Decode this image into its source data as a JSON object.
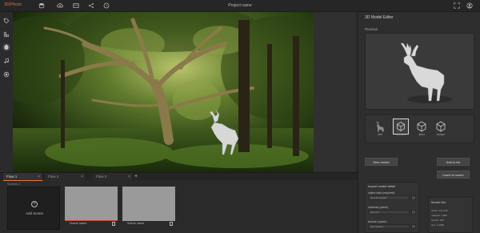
{
  "app": {
    "brand": "3DPhoto",
    "project_name": "Project name"
  },
  "topbar": {
    "icons": [
      "save-icon",
      "cloud-upload-icon",
      "preview-icon",
      "share-icon",
      "help-icon"
    ],
    "right_icons": [
      "fullscreen-icon",
      "account-icon"
    ]
  },
  "leftbar": {
    "icons": [
      "tag-icon",
      "layout-icon",
      "3d-model-icon",
      "music-icon",
      "marker-icon"
    ],
    "active_index": 2
  },
  "editor": {
    "title": "3D Model Editor",
    "preview_label": "Preview",
    "models": [
      {
        "label": "deer"
      },
      {
        "label": "selected"
      },
      {
        "label": "asset"
      },
      {
        "label": "custom"
      }
    ],
    "new_model_button": "New model",
    "add_to_list_button": "Add to list",
    "insert_button": "Insert to scene",
    "import": {
      "title": "Import model detail",
      "fields": [
        {
          "label": "object data (required)",
          "value": "deer.fbx/obj/gltf"
        },
        {
          "label": "material (option)",
          "value": "deer.mtl"
        },
        {
          "label": "texture (option)",
          "value": "deer.texture"
        }
      ]
    },
    "model_info": {
      "title": "Model info",
      "lines": [
        "vertex: 102,215",
        "material: 1,000",
        "texture: 200",
        "size: 1.2MB"
      ]
    }
  },
  "tabs": [
    {
      "label": "Flow 1",
      "active": true
    },
    {
      "label": "Flow 2",
      "active": false
    },
    {
      "label": "Flow 3",
      "active": false
    }
  ],
  "add_tab_label": "+",
  "scenes": {
    "label": "Scenes 1",
    "add_label": "Add Scene",
    "items": [
      {
        "label": "Scene name"
      },
      {
        "label": "Scene name"
      }
    ]
  },
  "colors": {
    "accent": "#e0763a",
    "scene_progress": "#d0463a"
  }
}
